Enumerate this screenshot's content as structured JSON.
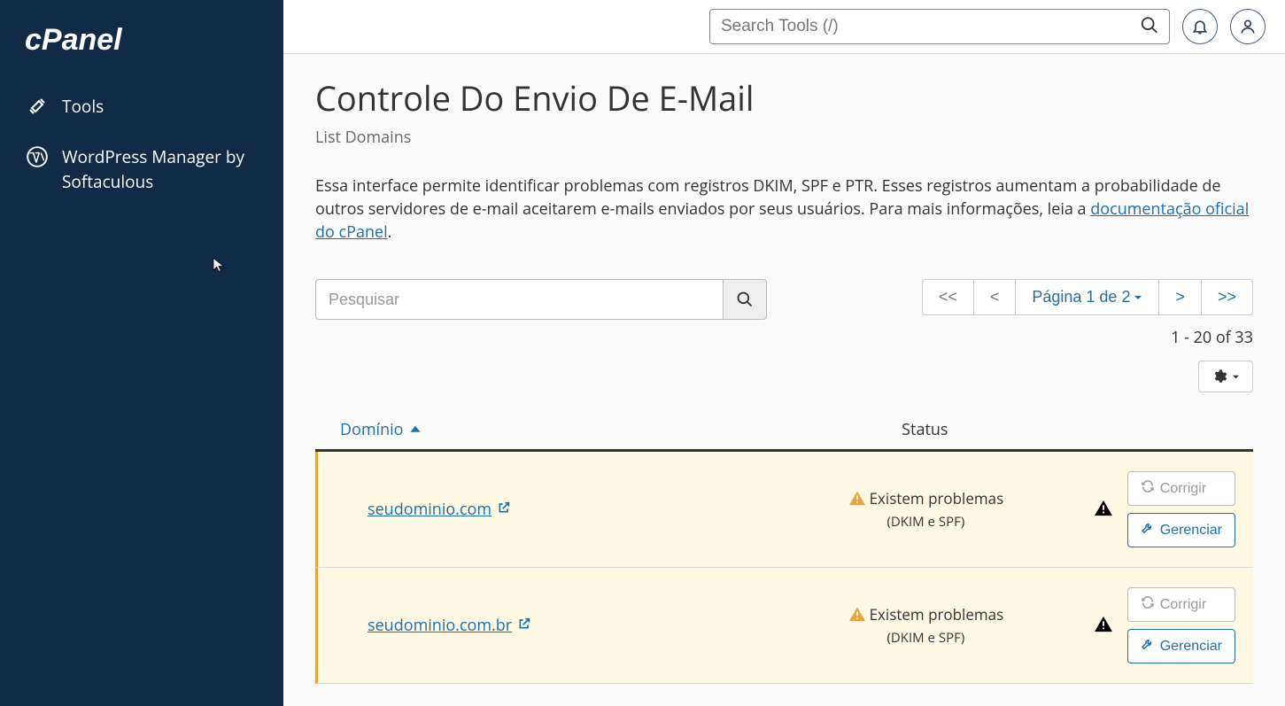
{
  "search_placeholder": "Search Tools (/)",
  "sidebar": {
    "tools_label": "Tools",
    "wp_label": "WordPress Manager by Softaculous"
  },
  "page": {
    "title": "Controle Do Envio De E-Mail",
    "subtitle": "List Domains",
    "desc_part1": "Essa interface permite identificar problemas com registros DKIM, SPF e PTR. Esses registros aumentam a probabilidade de outros servidores de e-mail aceitarem e-mails enviados por seus usuários. Para mais informações, leia a ",
    "desc_link": "documentação oficial do cPanel",
    "desc_part2": "."
  },
  "domain_search_placeholder": "Pesquisar",
  "pagination": {
    "first": "<<",
    "prev": "<",
    "current": "Página 1 de 2",
    "next": ">",
    "last": ">>",
    "count": "1 - 20 of 33"
  },
  "table": {
    "col_domain": "Domínio",
    "col_status": "Status",
    "status_text": "Existem problemas ",
    "status_detail": "(DKIM e SPF)",
    "btn_fix": "Corrigir",
    "btn_manage": "Gerenciar",
    "rows": [
      {
        "domain": "seudominio.com",
        "underline": true
      },
      {
        "domain": "seudominio.com.br",
        "underline": false
      }
    ]
  }
}
